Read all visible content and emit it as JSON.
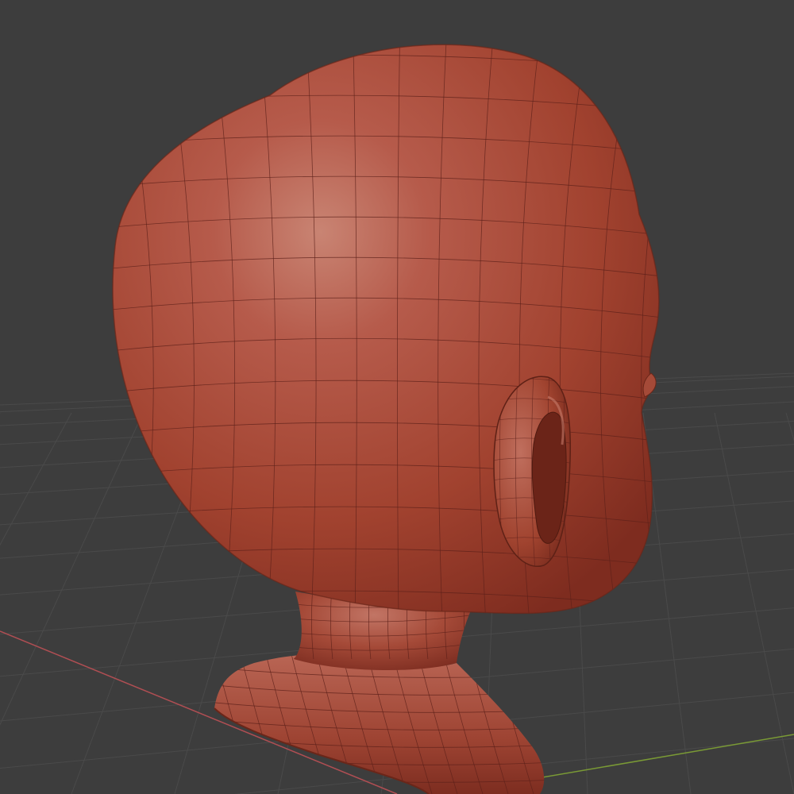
{
  "viewport": {
    "background": "#3d3d3d",
    "grid_color": "#4a4a4a",
    "x_axis_color": "#b04e53",
    "y_axis_color": "#7a9a35"
  },
  "model": {
    "type": "sculpted-head-mesh",
    "base_color": "#a8473a",
    "highlight_color": "#c77a6a",
    "shadow_color": "#7b2f24",
    "wire_color": "#5c2019",
    "parts": [
      "cranium",
      "ear",
      "neck",
      "shoulder-base",
      "nose-tip"
    ]
  }
}
